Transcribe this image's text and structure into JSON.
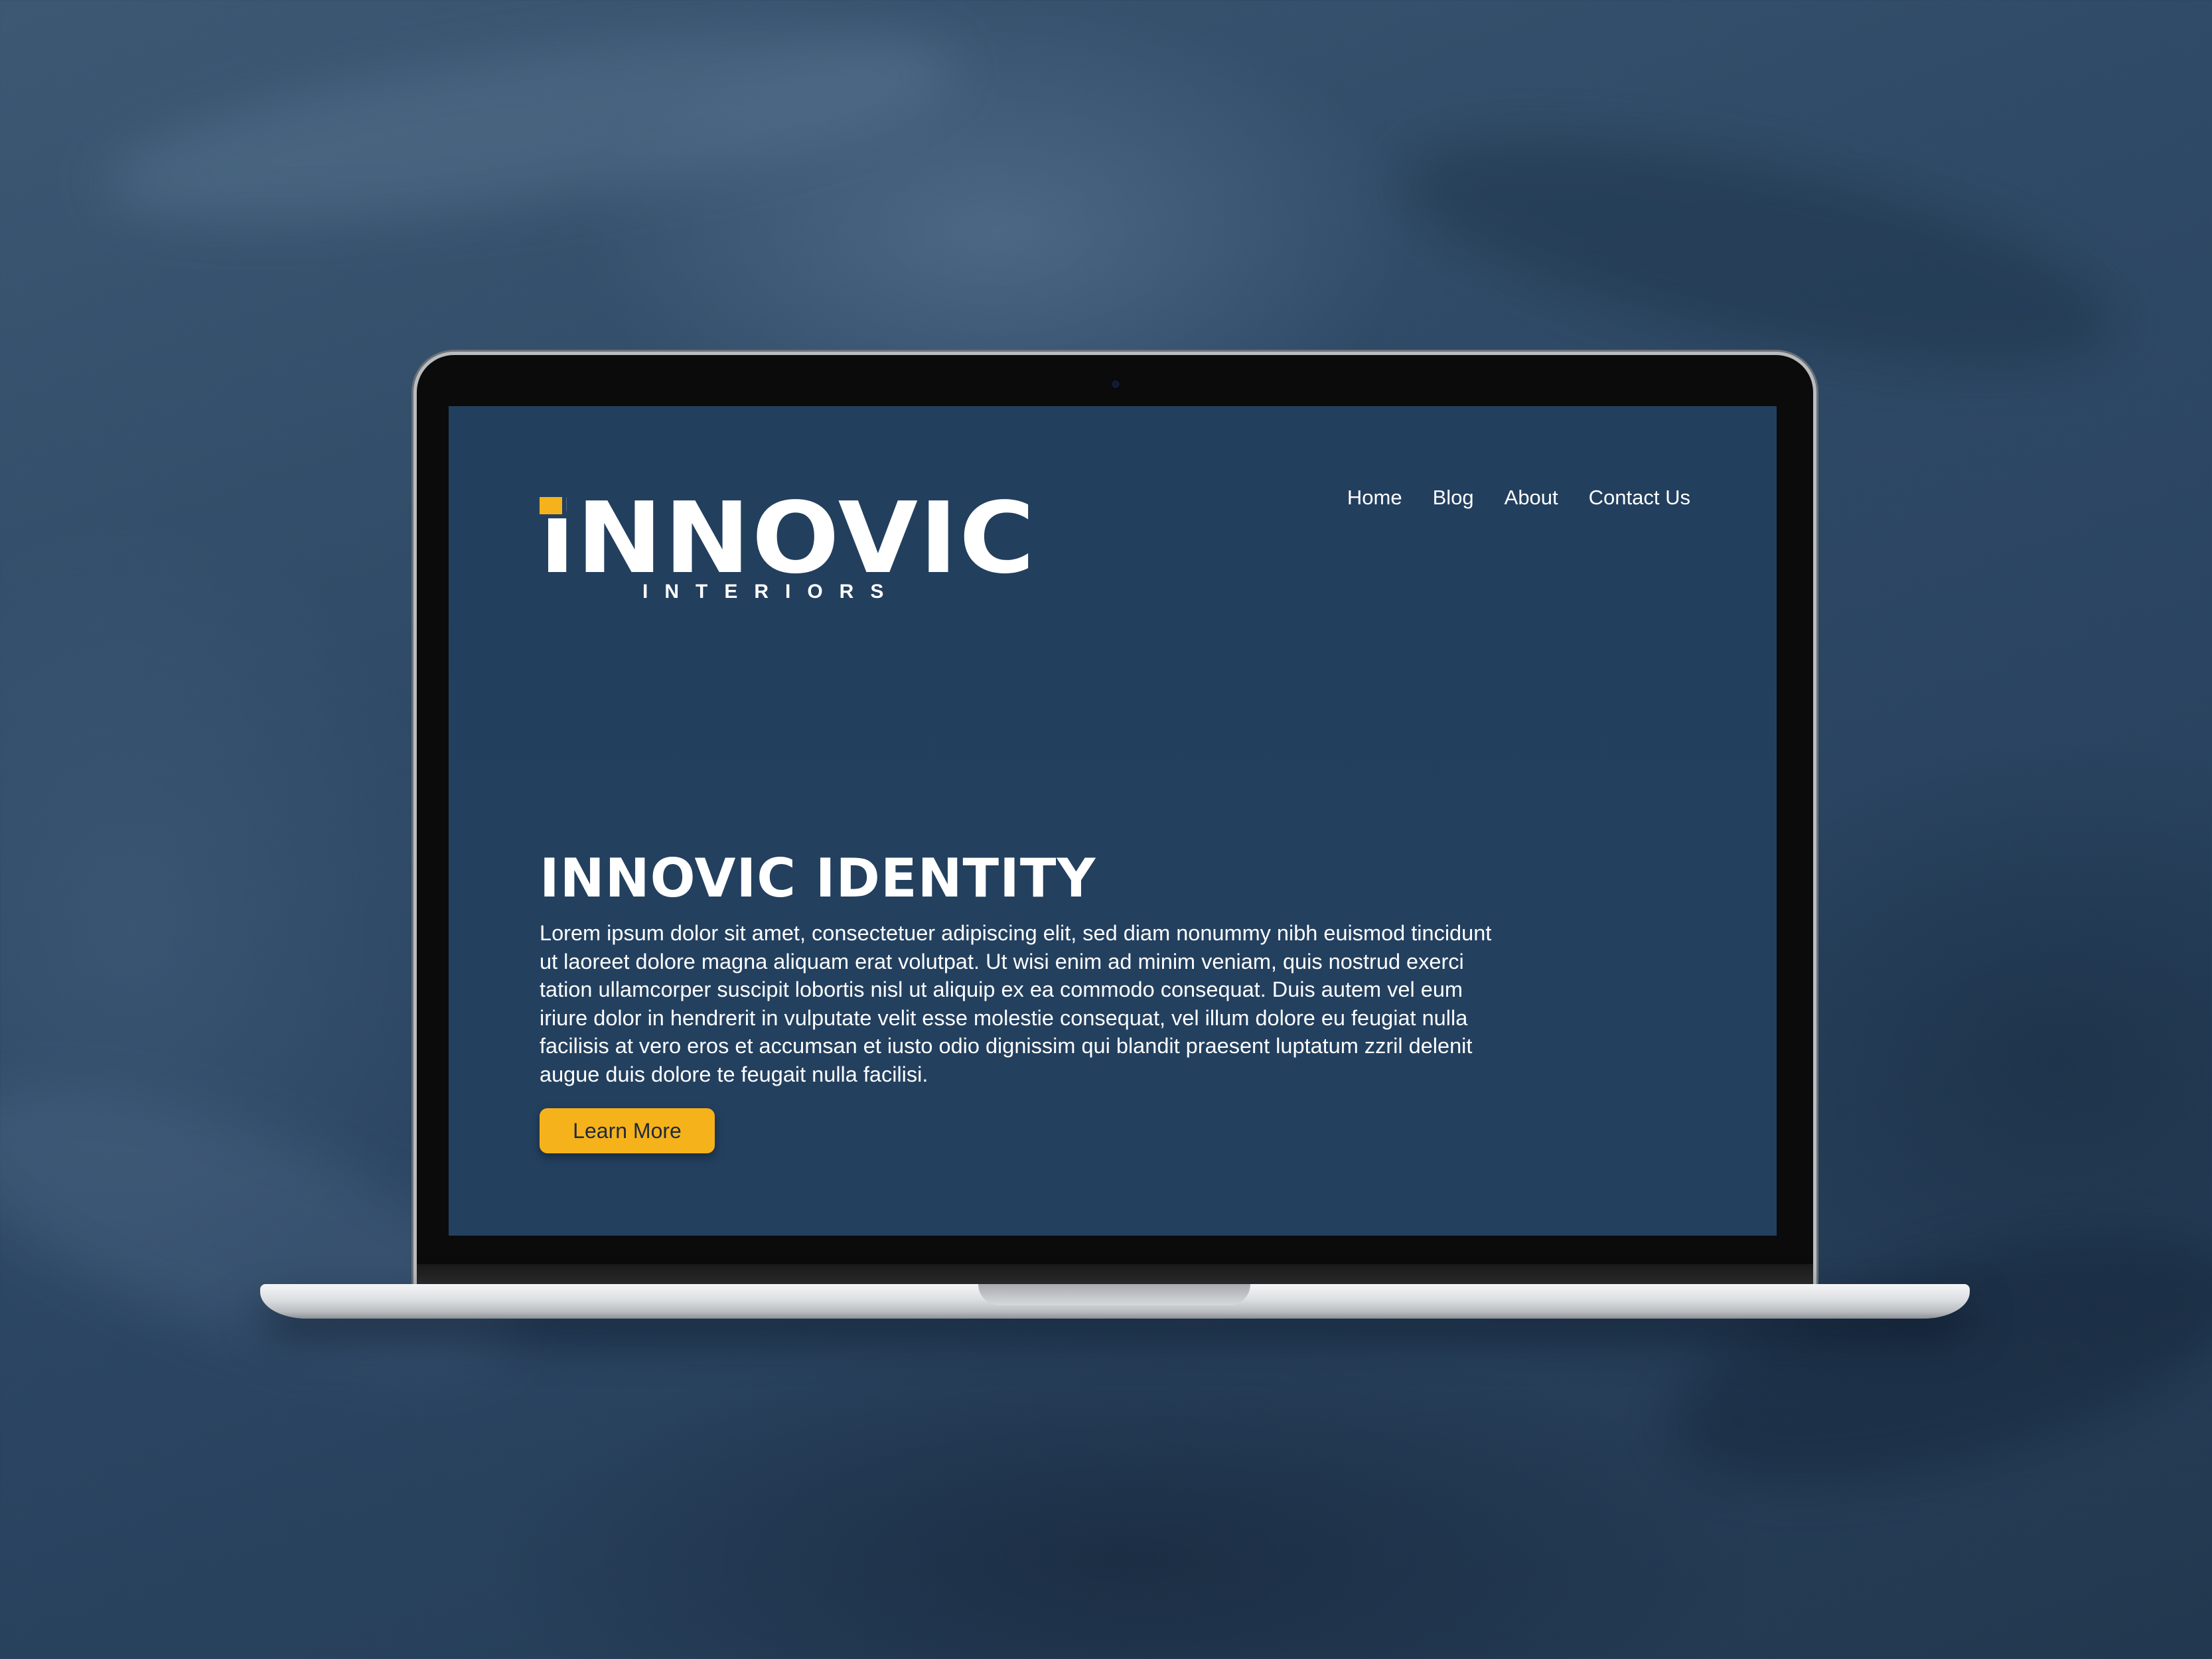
{
  "site": {
    "logo_word": "iNNOVIC",
    "logo_subtitle": "INTERIORS"
  },
  "nav": {
    "items": [
      {
        "label": "Home"
      },
      {
        "label": "Blog"
      },
      {
        "label": "About"
      },
      {
        "label": "Contact Us"
      }
    ]
  },
  "hero": {
    "title": "INNOVIC IDENTITY",
    "body": "Lorem ipsum dolor sit amet, consectetuer adipiscing elit, sed diam nonummy nibh euismod tincidunt ut laoreet dolore magna aliquam erat volutpat. Ut wisi enim ad minim veniam, quis nostrud exerci tation ullamcorper suscipit lobortis nisl ut aliquip ex ea commodo consequat. Duis autem vel eum iriure dolor in hendrerit in vulputate velit esse molestie consequat, vel illum dolore eu feugiat nulla facilisis at vero eros et accumsan et iusto odio dignissim qui blandit praesent luptatum zzril delenit augue duis dolore te feugait nulla facilisi.",
    "cta_label": "Learn More"
  },
  "colors": {
    "accent": "#f6b21b",
    "screen_background": "#233f5e",
    "page_background": "#2f4a66",
    "text": "#ffffff"
  }
}
